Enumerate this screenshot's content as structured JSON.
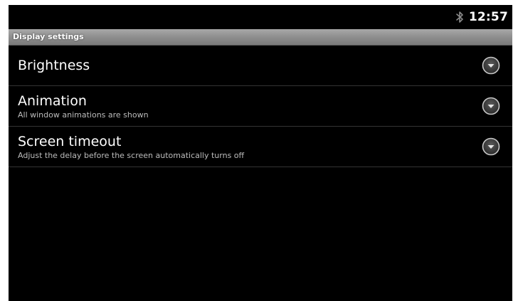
{
  "status_bar": {
    "time": "12:57",
    "icons": [
      "bluetooth-icon"
    ]
  },
  "header": {
    "title": "Display settings"
  },
  "preferences": [
    {
      "title": "Brightness",
      "summary": "",
      "control_icon": "dropdown-arrow-icon"
    },
    {
      "title": "Animation",
      "summary": "All window animations are shown",
      "control_icon": "dropdown-arrow-icon"
    },
    {
      "title": "Screen timeout",
      "summary": "Adjust the delay before the screen automatically turns off",
      "control_icon": "dropdown-arrow-icon"
    }
  ],
  "colors": {
    "background": "#000000",
    "title_bar": "#8c8c8c",
    "primary_text": "#ffffff",
    "secondary_text": "#bcbcbc",
    "divider": "#343434"
  }
}
